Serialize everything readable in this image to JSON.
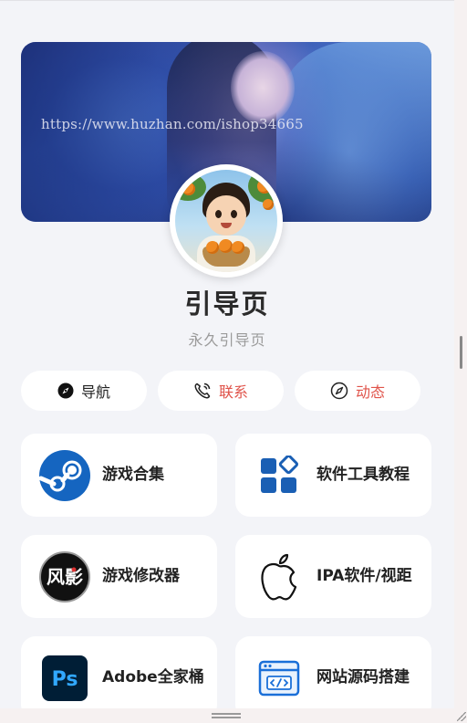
{
  "banner": {
    "watermark": "https://www.huzhan.com/ishop34665"
  },
  "profile": {
    "title": "引导页",
    "subtitle": "永久引导页"
  },
  "pills": [
    {
      "label": "导航",
      "icon": "compass-filled-icon",
      "color": "#222222"
    },
    {
      "label": "联系",
      "icon": "phone-call-icon",
      "color": "#e0534a"
    },
    {
      "label": "动态",
      "icon": "compass-outline-icon",
      "color": "#e0534a"
    }
  ],
  "cards": [
    {
      "label": "游戏合集",
      "icon": "steam-icon"
    },
    {
      "label": "软件工具教程",
      "icon": "apps-grid-icon"
    },
    {
      "label": "游戏修改器",
      "icon": "fengying-logo-icon",
      "logo_text": "风影"
    },
    {
      "label": "IPA软件/视距",
      "icon": "apple-icon"
    },
    {
      "label": "Adobe全家桶",
      "icon": "photoshop-icon",
      "logo_text": "Ps"
    },
    {
      "label": "网站源码搭建",
      "icon": "code-window-icon"
    }
  ],
  "colors": {
    "accent_red": "#e0534a",
    "steam_blue": "#1565c0",
    "app_blue": "#1a5fb4",
    "ps_blue": "#31a8ff",
    "ps_bg": "#001e36"
  }
}
